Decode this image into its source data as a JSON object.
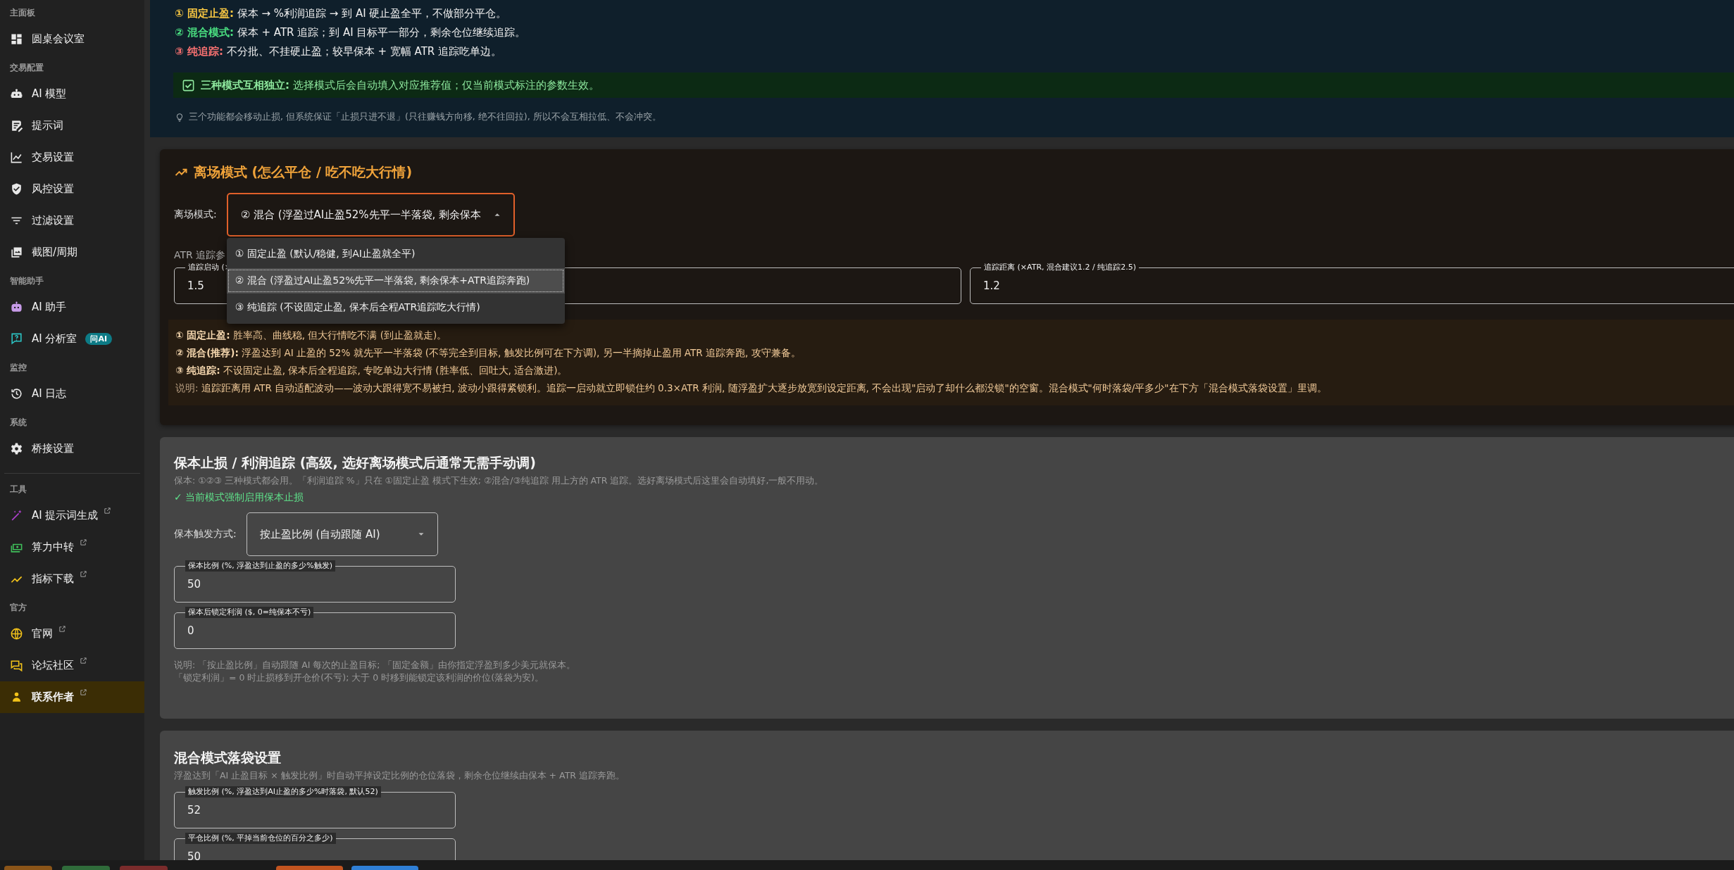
{
  "sidebar": {
    "sections": [
      {
        "title": "主面板",
        "divider_before": false,
        "items": [
          {
            "label": "圆桌会议室",
            "selected": false,
            "external": false
          }
        ]
      },
      {
        "title": "交易配置",
        "divider_before": false,
        "items": [
          {
            "label": "AI 模型",
            "selected": false,
            "external": false
          },
          {
            "label": "提示词",
            "selected": false,
            "external": false
          },
          {
            "label": "交易设置",
            "selected": false,
            "external": false
          },
          {
            "label": "风控设置",
            "selected": false,
            "external": false
          },
          {
            "label": "过滤设置",
            "selected": false,
            "external": false
          },
          {
            "label": "截图/周期",
            "selected": false,
            "external": false
          }
        ]
      },
      {
        "title": "智能助手",
        "divider_before": false,
        "items": [
          {
            "label": "AI 助手",
            "selected": false,
            "external": false
          },
          {
            "label": "AI 分析室",
            "selected": false,
            "external": false,
            "badge": "问AI"
          }
        ]
      },
      {
        "title": "监控",
        "divider_before": false,
        "items": [
          {
            "label": "AI 日志",
            "selected": false,
            "external": false
          }
        ]
      },
      {
        "title": "系统",
        "divider_before": false,
        "items": [
          {
            "label": "桥接设置",
            "selected": false,
            "external": false
          }
        ]
      },
      {
        "title": "工具",
        "divider_before": true,
        "items": [
          {
            "label": "AI 提示词生成",
            "selected": false,
            "external": true
          },
          {
            "label": "算力中转",
            "selected": false,
            "external": true
          },
          {
            "label": "指标下载",
            "selected": false,
            "external": true
          }
        ]
      },
      {
        "title": "官方",
        "divider_before": false,
        "items": [
          {
            "label": "官网",
            "selected": false,
            "external": true
          },
          {
            "label": "论坛社区",
            "selected": false,
            "external": true
          },
          {
            "label": "联系作者",
            "selected": true,
            "external": true
          }
        ]
      }
    ]
  },
  "mode_summary": {
    "lines": [
      {
        "label": "① 固定止盈:",
        "text": "保本 → %利润追踪 → 到 AI 硬止盈全平，不做部分平仓。",
        "color": "#f5c542"
      },
      {
        "label": "② 混合模式:",
        "text": "保本 + ATR 追踪；到 AI 目标平一部分，剩余仓位继续追踪。",
        "color": "#4ade80"
      },
      {
        "label": "③ 纯追踪:",
        "text": "不分批、不挂硬止盈；较早保本 + 宽幅 ATR 追踪吃单边。",
        "color": "#f87171"
      }
    ],
    "notice": {
      "label": "三种模式互相独立:",
      "text": "选择模式后会自动填入对应推荐值；仅当前模式标注的参数生效。",
      "checked": true
    },
    "hint": "三个功能都会移动止损, 但系统保证「止损只进不退」(只往赚钱方向移, 绝不往回拉), 所以不会互相拉低、不会冲突。"
  },
  "exit_mode": {
    "title": "离场模式 (怎么平仓 / 吃不吃大行情)",
    "select": {
      "label": "离场模式:",
      "value": "② 混合 (浮盈过AI止盈52%先平一半落袋, 剩余保本",
      "expanded": true,
      "options": [
        {
          "label": "① 固定止盈 (默认/稳健, 到AI止盈就全平)",
          "selected": false
        },
        {
          "label": "② 混合 (浮盈过AI止盈52%先平一半落袋, 剩余保本+ATR追踪奔跑)",
          "selected": true
        },
        {
          "label": "③ 纯追踪 (不设固定止盈, 保本后全程ATR追踪吃大行情)",
          "selected": false
        }
      ]
    },
    "atr_label": "ATR 追踪参",
    "fields": [
      {
        "label": "追踪启动 (×",
        "value": "1.5"
      },
      {
        "label": "追踪距离 (×ATR, 混合建议1.2 / 纯追踪2.5)",
        "value": "1.2"
      }
    ],
    "explain": [
      "**① 固定止盈:** 胜率高、曲线稳, 但大行情吃不满 (到止盈就走)。",
      "**② 混合(推荐):** 浮盈达到 AI 止盈的 52% 就先平一半落袋 (不等完全到目标, 触发比例可在下方调), 另一半摘掉止盈用 ATR 追踪奔跑, 攻守兼备。",
      "**③ 纯追踪:** 不设固定止盈, 保本后全程追踪, 专吃单边大行情 (胜率低、回吐大, 适合激进)。"
    ],
    "note": {
      "label": "说明:",
      "text": "追踪距离用 ATR 自动适配波动——波动大跟得宽不易被扫, 波动小跟得紧锁利。追踪一启动就立即锁住约 0.3×ATR 利润, 随浮盈扩大逐步放宽到设定距离, 不会出现\"启动了却什么都没锁\"的空窗。混合模式\"何时落袋/平多少\"在下方「混合模式落袋设置」里调。"
    }
  },
  "breakeven": {
    "title": "保本止损 / 利润追踪 (高级, 选好离场模式后通常无需手动调)",
    "desc": "保本: ①②③ 三种模式都会用。「利润追踪 %」只在 ①固定止盈 模式下生效; ②混合/③纯追踪 用上方的 ATR 追踪。选好离场模式后这里会自动填好,一般不用动。",
    "forced": "✓ 当前模式强制启用保本止损",
    "select": {
      "label": "保本触发方式:",
      "value": "按止盈比例 (自动跟随 AI)",
      "expanded": false
    },
    "fields": [
      {
        "label": "保本比例 (%, 浮盈达到止盈的多少%触发)",
        "value": "50"
      },
      {
        "label": "保本后锁定利润 ($, 0=纯保本不亏)",
        "value": "0"
      }
    ],
    "notes": [
      "说明: 「按止盈比例」自动跟随 AI 每次的止盈目标; 「固定金额」由你指定浮盈到多少美元就保本。",
      "「锁定利润」= 0 时止损移到开仓价(不亏); 大于 0 时移到能锁定该利润的价位(落袋为安)。"
    ]
  },
  "mixed": {
    "title": "混合模式落袋设置",
    "desc": "浮盈达到「AI 止盈目标 × 触发比例」时自动平掉设定比例的仓位落袋，剩余仓位继续由保本 + ATR 追踪奔跑。",
    "fields": [
      {
        "label": "触发比例 (%, 浮盈达到AI止盈的多少%时落袋, 默认52)",
        "value": "52"
      },
      {
        "label": "平仓比例 (%, 平掉当前仓位的百分之多少)",
        "value": "50"
      }
    ]
  },
  "taskbar": {
    "tabs": [
      {
        "color": "#8a5418"
      },
      {
        "color": "#2f6b3a"
      },
      {
        "color": "#7a2b2b"
      },
      {
        "color": "#c2541f"
      },
      {
        "color": "#2f7fd6"
      }
    ]
  }
}
